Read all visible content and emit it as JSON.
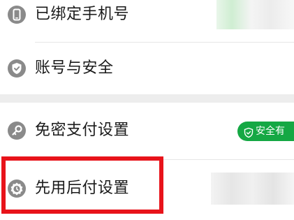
{
  "settings": {
    "rows": [
      {
        "label": "已绑定手机号",
        "icon": "phone-icon"
      },
      {
        "label": "账号与安全",
        "icon": "shield-check-icon"
      },
      {
        "label": "免密支付设置",
        "icon": "key-icon",
        "badge": "安全有"
      },
      {
        "label": "先用后付设置",
        "icon": "pay-later-icon"
      }
    ]
  },
  "colors": {
    "icon_gray": "#8a8a8a",
    "badge_green": "#15a844",
    "highlight_red": "#e8131a",
    "section_gap": "#ededed"
  }
}
